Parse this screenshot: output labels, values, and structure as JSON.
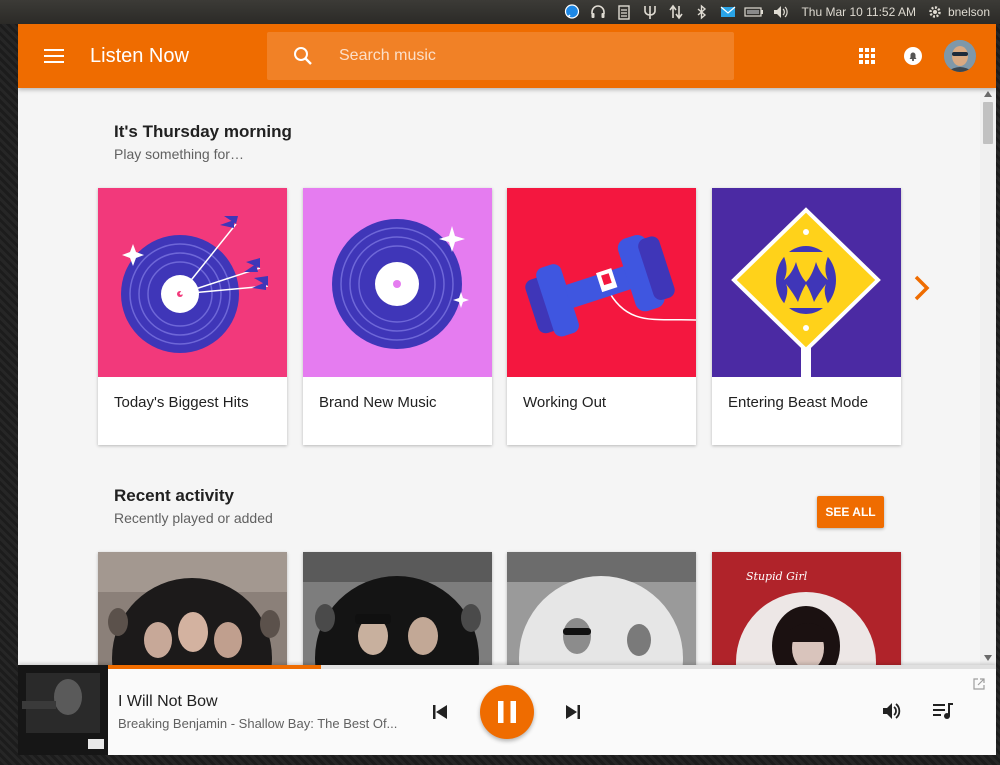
{
  "colors": {
    "accent": "#ef6c00",
    "panel": "#3c3b37",
    "text_primary": "#212121",
    "text_secondary": "#616161"
  },
  "system_panel": {
    "icons": [
      "chat-icon",
      "headphones-icon",
      "clipboard-icon",
      "trident-icon",
      "network-arrows-icon",
      "bluetooth-icon",
      "mail-icon",
      "battery-icon",
      "volume-icon"
    ],
    "clock": "Thu Mar 10 11:52 AM",
    "user": "bnelson"
  },
  "toolbar": {
    "title": "Listen Now",
    "search_placeholder": "Search music",
    "icons": [
      "menu-icon",
      "search-icon",
      "apps-grid-icon",
      "notifications-icon",
      "avatar"
    ]
  },
  "greeting": {
    "title": "It's Thursday morning",
    "subtitle": "Play something for…",
    "cards": [
      {
        "label": "Today's Biggest Hits",
        "art_bg": "#f2397b"
      },
      {
        "label": "Brand New Music",
        "art_bg": "#e57cf0"
      },
      {
        "label": "Working Out",
        "art_bg": "#f4173f"
      },
      {
        "label": "Entering Beast Mode",
        "art_bg": "#4b2aa3"
      }
    ]
  },
  "recent": {
    "title": "Recent activity",
    "subtitle": "Recently played or added",
    "see_all": "SEE ALL",
    "cards": [
      {
        "art_bg": "#8b8079"
      },
      {
        "art_bg": "#7d7d7d"
      },
      {
        "art_bg": "#9a9a9a"
      },
      {
        "art_bg": "#b0232a",
        "art_text": "Stupid Girl"
      }
    ]
  },
  "now_playing": {
    "title": "I Will Not Bow",
    "subtitle": "Breaking Benjamin - Shallow Bay: The Best Of...",
    "progress": 0.24
  }
}
